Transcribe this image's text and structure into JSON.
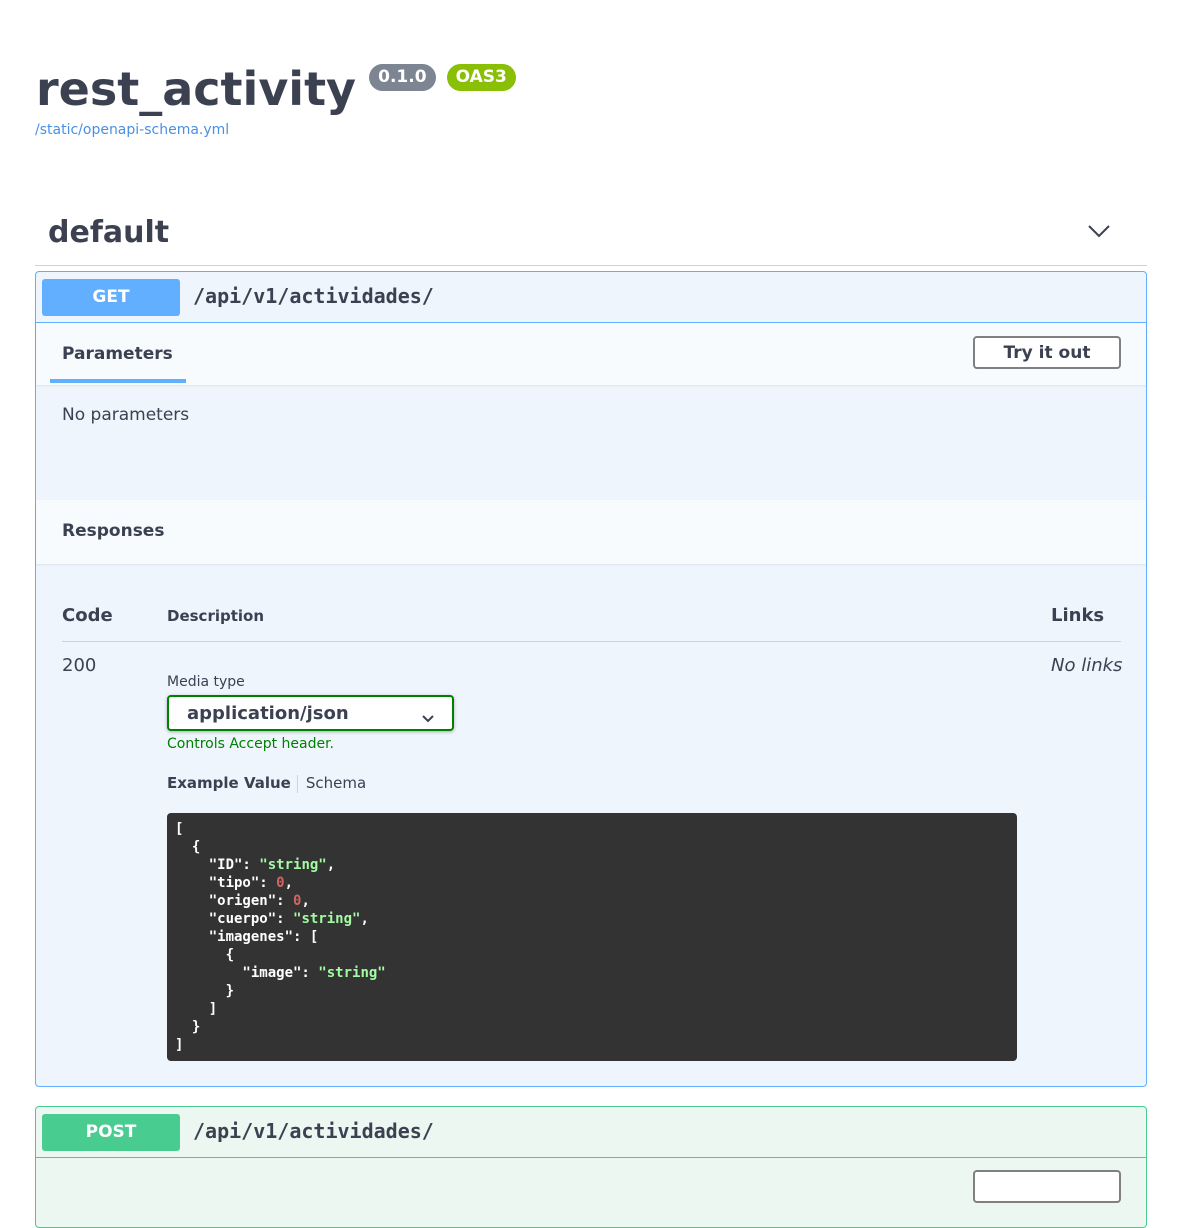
{
  "header": {
    "title": "rest_activity",
    "version_badge": "0.1.0",
    "oas_badge": "OAS3",
    "schema_link": "/static/openapi-schema.yml"
  },
  "tag": {
    "name": "default",
    "toggle_icon": "chevron-down-icon"
  },
  "operations": [
    {
      "method": "GET",
      "path": "/api/v1/actividades/",
      "parameters_tab": "Parameters",
      "try_button": "Try it out",
      "no_params": "No parameters",
      "responses_title": "Responses",
      "columns": {
        "code": "Code",
        "description": "Description",
        "links": "Links"
      },
      "response": {
        "code": "200",
        "links": "No links",
        "media_type_label": "Media type",
        "media_type": "application/json",
        "controls_note": "Controls Accept header.",
        "example_tab": "Example Value",
        "schema_tab": "Schema",
        "example_lines": [
          [
            [
              "p",
              "["
            ]
          ],
          [
            [
              "p",
              "  {"
            ]
          ],
          [
            [
              "p",
              "    \"ID\": "
            ],
            [
              "s",
              "\"string\""
            ],
            [
              "p",
              ","
            ]
          ],
          [
            [
              "p",
              "    \"tipo\": "
            ],
            [
              "n",
              "0"
            ],
            [
              "p",
              ","
            ]
          ],
          [
            [
              "p",
              "    \"origen\": "
            ],
            [
              "n",
              "0"
            ],
            [
              "p",
              ","
            ]
          ],
          [
            [
              "p",
              "    \"cuerpo\": "
            ],
            [
              "s",
              "\"string\""
            ],
            [
              "p",
              ","
            ]
          ],
          [
            [
              "p",
              "    \"imagenes\": ["
            ]
          ],
          [
            [
              "p",
              "      {"
            ]
          ],
          [
            [
              "p",
              "        \"image\": "
            ],
            [
              "s",
              "\"string\""
            ]
          ],
          [
            [
              "p",
              "      }"
            ]
          ],
          [
            [
              "p",
              "    ]"
            ]
          ],
          [
            [
              "p",
              "  }"
            ]
          ],
          [
            [
              "p",
              "]"
            ]
          ]
        ]
      }
    },
    {
      "method": "POST",
      "path": "/api/v1/actividades/"
    }
  ],
  "colors": {
    "get": "#61affe",
    "post": "#49cc90",
    "version_badge": "#7d8492",
    "oas_badge": "#89bf04",
    "link": "#4990e2",
    "accept_note": "#008000"
  }
}
